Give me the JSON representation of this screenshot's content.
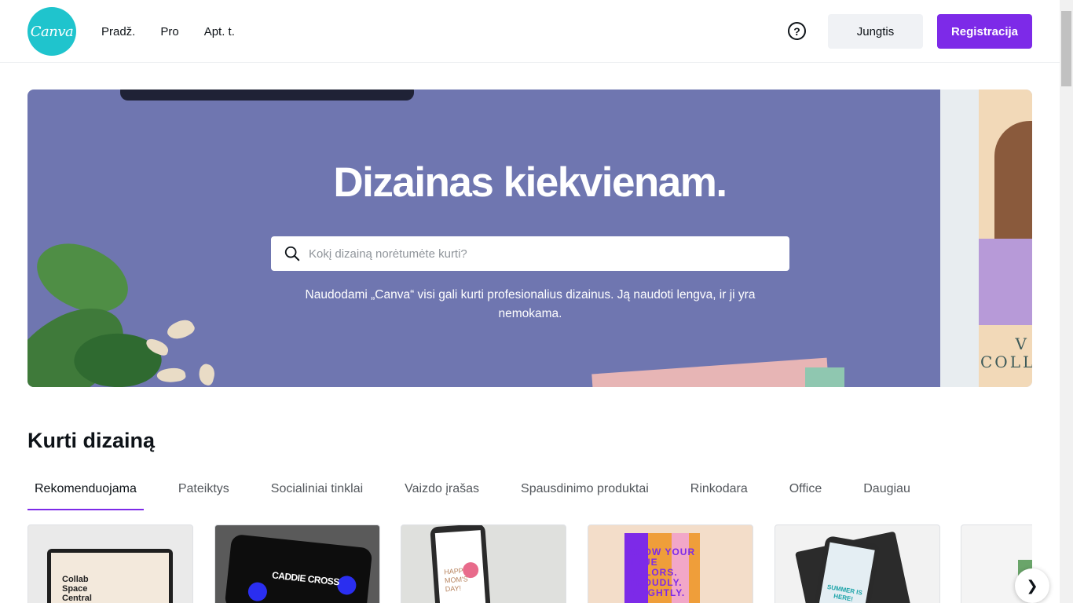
{
  "header": {
    "logo_text": "Canva",
    "nav": [
      "Pradž.",
      "Pro",
      "Apt. t."
    ],
    "help_icon": "question-circle-icon",
    "login_label": "Jungtis",
    "signup_label": "Registracija"
  },
  "hero": {
    "title": "Dizainas kiekvienam.",
    "search_placeholder": "Kokį dizainą norėtumėte kurti?",
    "subtitle": "Naudodami „Canva“ visi gali kurti profesionalius dizainus. Ją naudoti lengva, ir ji yra nemokama.",
    "photo_text_line1": "V",
    "photo_text_line2": "COLL"
  },
  "section": {
    "title": "Kurti dizainą",
    "tabs": [
      "Rekomenduojama",
      "Pateiktys",
      "Socialiniai tinklai",
      "Vaizdo įrašas",
      "Spausdinimo produktai",
      "Rinkodara",
      "Office",
      "Daugiau"
    ]
  },
  "cards": {
    "card1_text": "Collab Space Central",
    "card2_text": "CADDIE CROSS",
    "card3_text": "HAPPY MOM'S DAY!",
    "card4_text": "SHOW YOUR TRUE COLORS. PROUDLY. BRIGHTLY.",
    "card5_text": "SUMMER IS HERE!"
  },
  "colors": {
    "brand": "#7d2ae8",
    "logo": "#1fc4cd",
    "hero_bg": "#6f76b0"
  }
}
